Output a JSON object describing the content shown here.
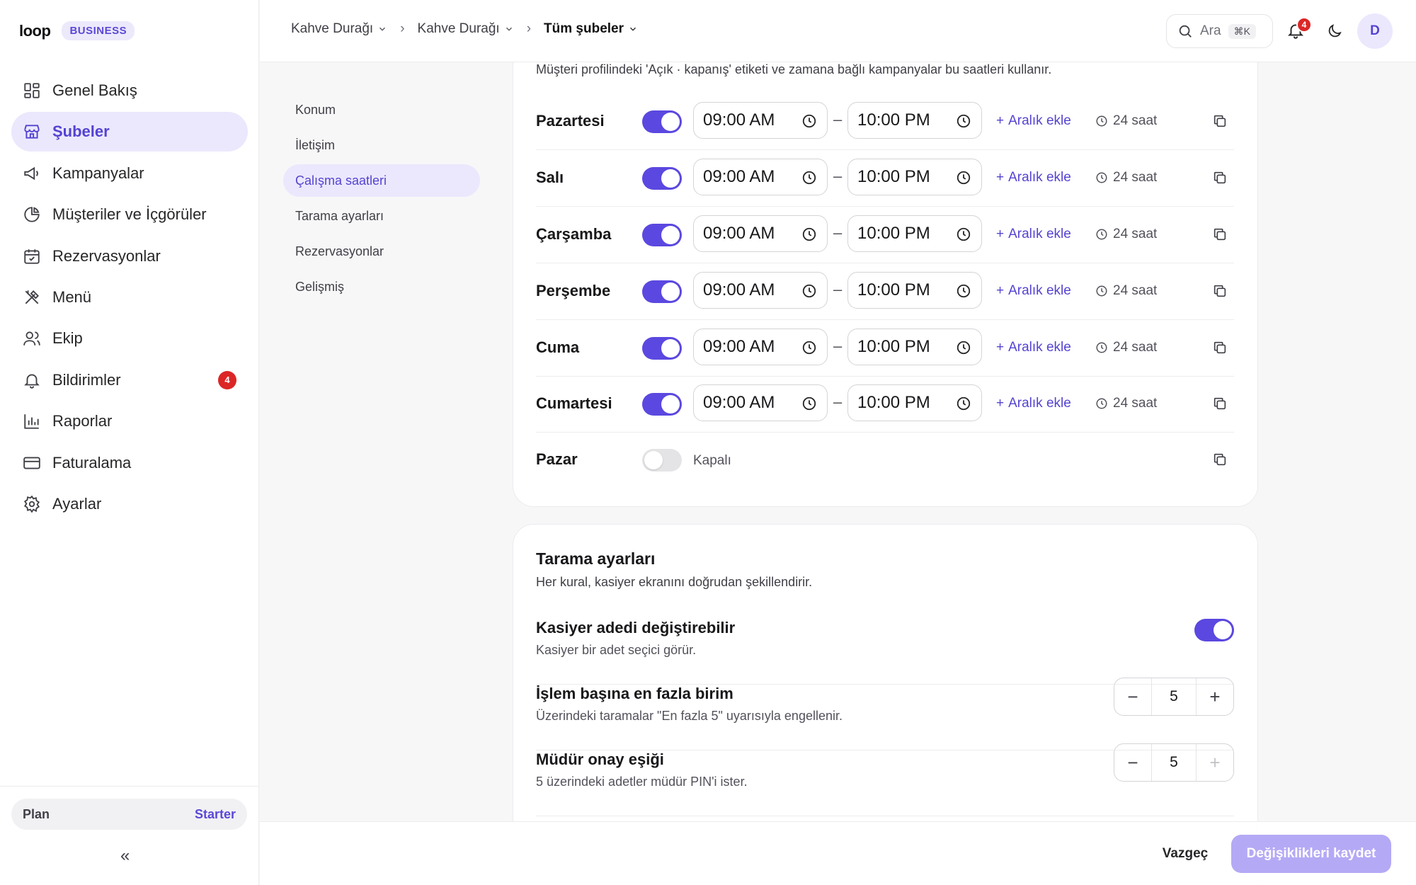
{
  "brand": {
    "logo": "loop",
    "badge": "BUSINESS"
  },
  "sidebar": {
    "items": [
      {
        "label": "Genel Bakış",
        "icon": "grid-icon"
      },
      {
        "label": "Şubeler",
        "icon": "store-icon",
        "active": true
      },
      {
        "label": "Kampanyalar",
        "icon": "megaphone-icon"
      },
      {
        "label": "Müşteriler ve İçgörüler",
        "icon": "pie-chart-icon"
      },
      {
        "label": "Rezervasyonlar",
        "icon": "calendar-icon"
      },
      {
        "label": "Menü",
        "icon": "utensils-icon"
      },
      {
        "label": "Ekip",
        "icon": "users-icon"
      },
      {
        "label": "Bildirimler",
        "icon": "bell-icon",
        "badge": "4"
      },
      {
        "label": "Raporlar",
        "icon": "bar-chart-icon"
      },
      {
        "label": "Faturalama",
        "icon": "credit-card-icon"
      },
      {
        "label": "Ayarlar",
        "icon": "gear-icon"
      }
    ],
    "plan": {
      "label": "Plan",
      "value": "Starter"
    },
    "collapse": "«"
  },
  "topbar": {
    "breadcrumbs": [
      "Kahve Durağı",
      "Kahve Durağı",
      "Tüm şubeler"
    ],
    "search": {
      "placeholder": "Ara",
      "shortcut": "⌘K"
    },
    "notification_count": "4",
    "avatar_initial": "D"
  },
  "subnav": {
    "items": [
      "Konum",
      "İletişim",
      "Çalışma saatleri",
      "Tarama ayarları",
      "Rezervasyonlar",
      "Gelişmiş"
    ],
    "active_index": 2
  },
  "hours": {
    "subtitle": "Müşteri profilindeki 'Açık · kapanış' etiketi ve zamana bağlı kampanyalar bu saatleri kullanır.",
    "add_range_label": "Aralık ekle",
    "closed_label": "Kapalı",
    "days": [
      {
        "name": "Pazartesi",
        "open": true,
        "from": "09:00 AM",
        "to": "10:00 PM",
        "duration": "24 saat"
      },
      {
        "name": "Salı",
        "open": true,
        "from": "09:00 AM",
        "to": "10:00 PM",
        "duration": "24 saat"
      },
      {
        "name": "Çarşamba",
        "open": true,
        "from": "09:00 AM",
        "to": "10:00 PM",
        "duration": "24 saat"
      },
      {
        "name": "Perşembe",
        "open": true,
        "from": "09:00 AM",
        "to": "10:00 PM",
        "duration": "24 saat"
      },
      {
        "name": "Cuma",
        "open": true,
        "from": "09:00 AM",
        "to": "10:00 PM",
        "duration": "24 saat"
      },
      {
        "name": "Cumartesi",
        "open": true,
        "from": "09:00 AM",
        "to": "10:00 PM",
        "duration": "24 saat"
      },
      {
        "name": "Pazar",
        "open": false
      }
    ]
  },
  "scan": {
    "title": "Tarama ayarları",
    "subtitle": "Her kural, kasiyer ekranını doğrudan şekillendirir.",
    "rows": [
      {
        "title": "Kasiyer adedi değiştirebilir",
        "desc": "Kasiyer bir adet seçici görür.",
        "toggle_on": true
      },
      {
        "title": "İşlem başına en fazla birim",
        "desc": "Üzerindeki taramalar \"En fazla 5\" uyarısıyla engellenir.",
        "value": "5"
      },
      {
        "title": "Müdür onay eşiği",
        "desc": "5 üzerindeki adetler müdür PIN'i ister.",
        "value": "5"
      }
    ]
  },
  "footer": {
    "cancel": "Vazgeç",
    "save": "Değişiklikleri kaydet"
  },
  "colors": {
    "accent": "#5b48e0",
    "accent_soft": "#ebe8fd",
    "danger": "#dc2626"
  }
}
